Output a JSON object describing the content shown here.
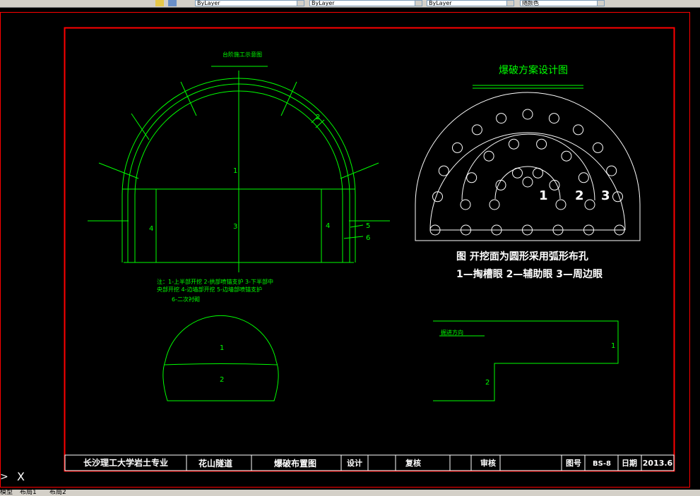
{
  "toolbar": {
    "combos": [
      "ByLayer",
      "ByLayer",
      "ByLayer",
      "随颜色"
    ]
  },
  "drawing": {
    "left_top_label": "台阶施工示意图",
    "left_region_labels": [
      "1",
      "2",
      "3",
      "4",
      "4",
      "5",
      "6"
    ],
    "left_notes": [
      "注：1-上半部开挖  2-拱部喷锚支护  3-下半部中",
      "央部开挖  4-边墙部开挖  5-边墙部喷锚支护",
      "6-二次衬砌"
    ],
    "small_section_labels": [
      "1",
      "2"
    ],
    "right_title": "爆破方案设计图",
    "hole_legend_numbers": [
      "1",
      "2",
      "3"
    ],
    "caption_line1": "图  开挖面为圆形采用弧形布孔",
    "caption_line2": "1—掏槽眼  2—辅助眼 3—周边眼",
    "step_label": "掘进方向",
    "step_region_labels": [
      "1",
      "2"
    ]
  },
  "title_block": {
    "school": "长沙理工大学岩土专业",
    "project": "花山隧道",
    "drawing_name": "爆破布置图",
    "design": "设计",
    "review": "复核",
    "audit": "审核",
    "drawing_no_label": "图号",
    "drawing_no": "BS-8",
    "date_label": "日期",
    "date": "2013.6"
  },
  "ucs": {
    "prompt": ">",
    "axis": "X"
  },
  "layout_tabs": [
    "模型",
    "布局1",
    "布局2"
  ],
  "colors": {
    "canvas": "#000000",
    "frame": "#ff0000",
    "cad_green": "#00ff00",
    "cad_white": "#ffffff"
  }
}
